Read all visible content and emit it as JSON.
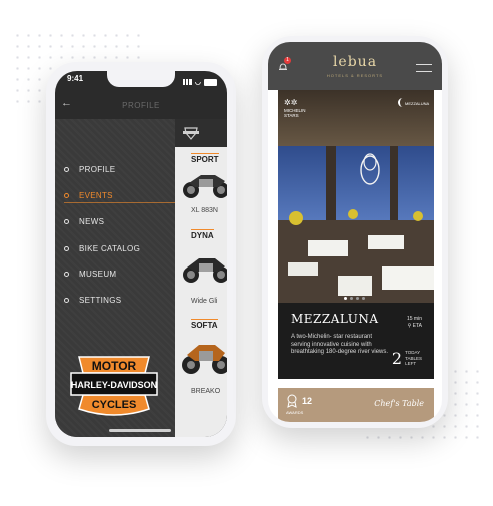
{
  "phone1": {
    "status_time": "9:41",
    "nav_title": "PROFILE",
    "menu": [
      {
        "label": "PROFILE",
        "active": false
      },
      {
        "label": "EVENTS",
        "active": true
      },
      {
        "label": "NEWS",
        "active": false
      },
      {
        "label": "BIKE CATALOG",
        "active": false
      },
      {
        "label": "MUSEUM",
        "active": false
      },
      {
        "label": "SETTINGS",
        "active": false
      }
    ],
    "logo": {
      "top": "MOTOR",
      "middle": "HARLEY-DAVIDSON",
      "bottom": "CYCLES"
    },
    "catalog": [
      {
        "heading": "SPORT",
        "model": "XL 883N"
      },
      {
        "heading": "DYNA",
        "model": "Wide Gli"
      },
      {
        "heading": "SOFTA",
        "model": "BREAKO"
      }
    ],
    "accent": "#f08a2c"
  },
  "phone2": {
    "brand": "lebua",
    "brand_sub": "HOTELS & RESORTS",
    "notification_count": "1",
    "michelin": "MICHELIN STARS",
    "hero_brand": "MEZZALUNA",
    "title": "MEZZALUNA",
    "description": "A two-Michelin- star restaurant serving innovative cuisine with breathtaking 180-degree river views.",
    "eta_time": "15 min",
    "eta_label": "ETA",
    "tables_count": "2",
    "tables_label_1": "TODAY",
    "tables_label_2": "TABLES",
    "tables_label_3": "LEFT",
    "awards_count": "12",
    "awards_label": "AWARDS",
    "signature": "Chef's Table"
  }
}
